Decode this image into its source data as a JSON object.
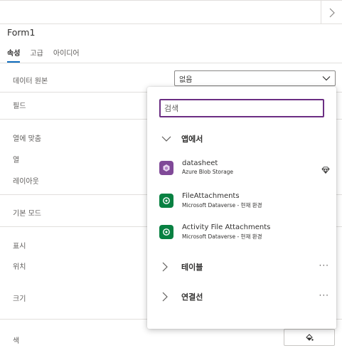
{
  "form": {
    "title": "Form1",
    "tabs": [
      {
        "label": "속성",
        "active": true
      },
      {
        "label": "고급",
        "active": false
      },
      {
        "label": "아이디어",
        "active": false
      }
    ]
  },
  "properties": {
    "data_source_label": "데이터 원본",
    "data_source_value": "없음",
    "fields_label": "필드",
    "snap_to_columns_label": "열에 맞춤",
    "columns_label": "열",
    "layout_label": "레이아웃",
    "default_mode_label": "기본 모드",
    "display_label": "표시",
    "position_label": "위치",
    "size_label": "크기",
    "color_label": "색"
  },
  "dropdown_panel": {
    "search_placeholder": "검색",
    "in_app_section": "앱에서",
    "tables_section": "테이블",
    "connectors_section": "연결선",
    "more_label": "···",
    "items": [
      {
        "name": "datasheet",
        "subtitle": "Azure Blob Storage",
        "icon": "azure-blob-storage-icon",
        "premium": true
      },
      {
        "name": "FileAttachments",
        "subtitle": "Microsoft Dataverse - 현재 환경",
        "icon": "dataverse-icon",
        "premium": false
      },
      {
        "name": "Activity File Attachments",
        "subtitle": "Microsoft Dataverse - 현재 환경",
        "icon": "dataverse-icon",
        "premium": false
      }
    ]
  },
  "colors": {
    "accent_tab": "#0f6cbd",
    "search_border": "#6b2e83",
    "blob_icon": "#804998",
    "dataverse_icon": "#088142"
  }
}
